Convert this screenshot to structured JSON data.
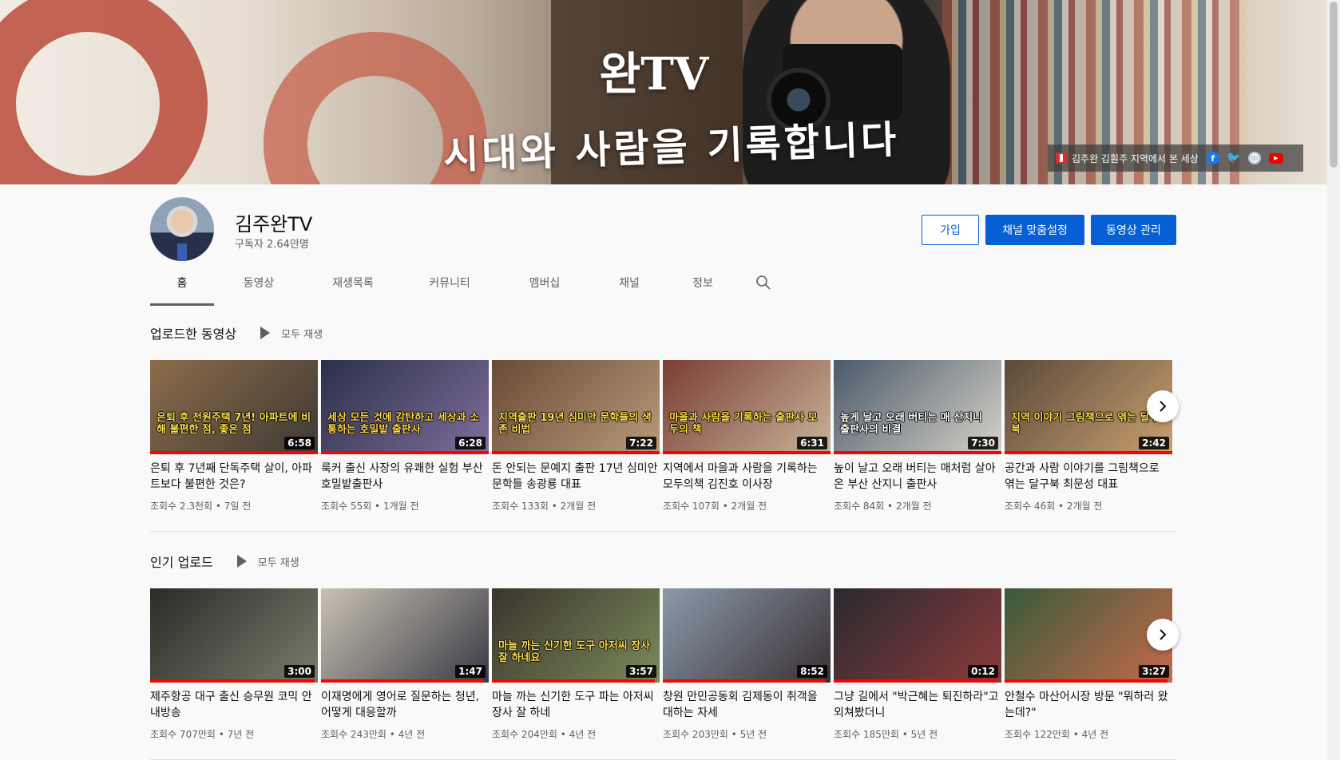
{
  "banner": {
    "title": "완TV",
    "slogan": "시대와 사람을 기록합니다",
    "link_text": "김주완 김훤주 지역에서 본 세상",
    "social": [
      "facebook-icon",
      "twitter-icon",
      "website-icon",
      "youtube-icon"
    ]
  },
  "channel": {
    "name": "김주완TV",
    "subscribers": "구독자 2.64만명",
    "join_label": "가입",
    "customize_label": "채널 맞춤설정",
    "manage_label": "동영상 관리"
  },
  "tabs": [
    {
      "label": "홈",
      "active": true
    },
    {
      "label": "동영상",
      "active": false
    },
    {
      "label": "재생목록",
      "active": false
    },
    {
      "label": "커뮤니티",
      "active": false
    },
    {
      "label": "멤버십",
      "active": false
    },
    {
      "label": "채널",
      "active": false
    },
    {
      "label": "정보",
      "active": false
    }
  ],
  "shelves": [
    {
      "title": "업로드한 동영상",
      "play_all": "모두 재생",
      "videos": [
        {
          "title": "은퇴 후 7년째 단독주택 살이, 아파트보다 불편한 것은?",
          "meta": "조회수 2.3천회 • 7일 전",
          "duration": "6:58",
          "overlay": "은퇴 후 전원주택 7년! 아파트에 비해 불편한 점, 좋은 점",
          "colors": [
            "#8c6b4a",
            "#3e3a36"
          ],
          "overlay_color": "#ffe14d",
          "progress": 1.0
        },
        {
          "title": "룩커 출신 사장의 유쾌한 실험 부산 호밀밭출판사",
          "meta": "조회수 55회 • 1개월 전",
          "duration": "6:28",
          "overlay": "세상 모든 것에 감탄하고 세상과 소통하는 호밀밭 출판사",
          "colors": [
            "#2a2f4a",
            "#7f6f9a"
          ],
          "overlay_color": "#ffd54a",
          "progress": 1.0
        },
        {
          "title": "돈 안되는 문예지 출판 17년 심미안 문학들 송광룡 대표",
          "meta": "조회수 133회 • 2개월 전",
          "duration": "7:22",
          "overlay": "지역출판 19년 심미안 문학들의 생존 비법",
          "colors": [
            "#6b4a36",
            "#b89a7a"
          ],
          "overlay_color": "#ffe14d",
          "progress": 1.0
        },
        {
          "title": "지역에서 마을과 사람을 기록하는 모두의책 김진호 이사장",
          "meta": "조회수 107회 • 2개월 전",
          "duration": "6:31",
          "overlay": "마을과 사람을 기록하는 출판사 모두의 책",
          "colors": [
            "#7a3e34",
            "#c9b29a"
          ],
          "overlay_color": "#ffe14d",
          "progress": 1.0
        },
        {
          "title": "높이 날고 오래 버티는 매처럼 살아온 부산 산지니 출판사",
          "meta": "조회수 84회 • 2개월 전",
          "duration": "7:30",
          "overlay": "높게 날고 오래 버티는 매 산지니 출판사의 비결",
          "colors": [
            "#4a5a6a",
            "#d7d2c8"
          ],
          "overlay_color": "#ffffff",
          "progress": 1.0
        },
        {
          "title": "공간과 사람 이야기를 그림책으로 엮는 달구북 최문성 대표",
          "meta": "조회수 46회 • 2개월 전",
          "duration": "2:42",
          "overlay": "지역 이야기 그림책으로 엮는 달구북",
          "colors": [
            "#5a4a3a",
            "#caa070"
          ],
          "overlay_color": "#ffe14d",
          "progress": 1.0
        }
      ]
    },
    {
      "title": "인기 업로드",
      "play_all": "모두 재생",
      "videos": [
        {
          "title": "제주항공 대구 출신 승무원 코믹 안내방송",
          "meta": "조회수 707만회 • 7년 전",
          "duration": "3:00",
          "overlay": "",
          "colors": [
            "#2b2b28",
            "#7a7a6a"
          ],
          "overlay_color": "#ffffff",
          "progress": 0.98
        },
        {
          "title": "이재명에게 영어로 질문하는 청년, 어떻게 대응할까",
          "meta": "조회수 243만회 • 4년 전",
          "duration": "1:47",
          "overlay": "",
          "colors": [
            "#c9c2b4",
            "#3a3a44"
          ],
          "overlay_color": "#ffffff",
          "progress": 0.97
        },
        {
          "title": "마늘 까는 신기한 도구 파는 아저씨 장사 잘 하네",
          "meta": "조회수 204만회 • 4년 전",
          "duration": "3:57",
          "overlay": "마늘 까는 신기한 도구 아저씨 장사 잘 하네요",
          "colors": [
            "#3a342c",
            "#7a8a5a"
          ],
          "overlay_color": "#ffe14d",
          "progress": 0.97
        },
        {
          "title": "창원 만민공동회 김제동이 취객을 대하는 자세",
          "meta": "조회수 203만회 • 5년 전",
          "duration": "8:52",
          "overlay": "",
          "colors": [
            "#8a9aaa",
            "#3a3034"
          ],
          "overlay_color": "#ffffff",
          "progress": 0.97
        },
        {
          "title": "그냥 길에서 \"박근혜는 퇴진하라\"고 외쳐봤더니",
          "meta": "조회수 185만회 • 5년 전",
          "duration": "0:12",
          "overlay": "",
          "colors": [
            "#2a2a30",
            "#8a3a3a"
          ],
          "overlay_color": "#ffffff",
          "progress": 0.97
        },
        {
          "title": "안철수 마산어시장 방문 \"뭐하러 왔는데?\"",
          "meta": "조회수 122만회 • 4년 전",
          "duration": "3:27",
          "overlay": "",
          "colors": [
            "#3a5a3a",
            "#c46a4a"
          ],
          "overlay_color": "#ffffff",
          "progress": 0.97
        }
      ]
    }
  ]
}
